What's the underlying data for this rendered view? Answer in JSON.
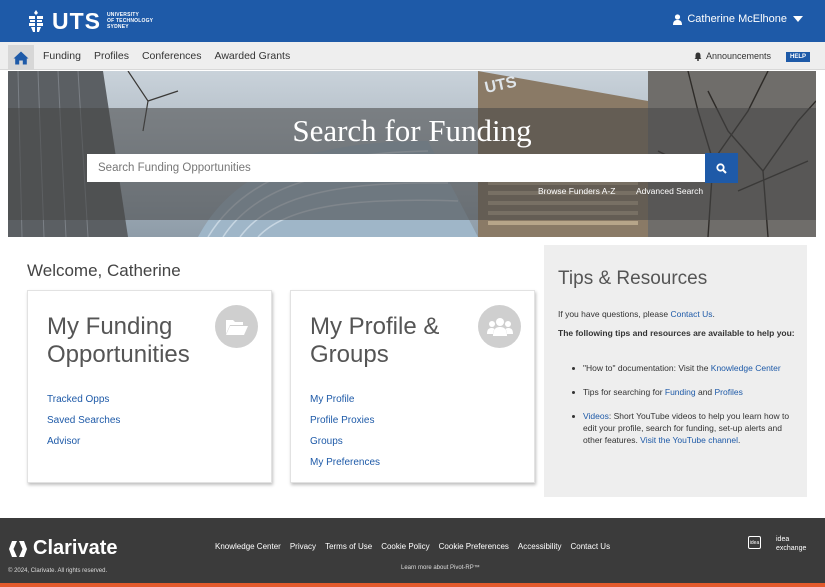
{
  "brand": {
    "logo_text": "UTS",
    "logo_sub": [
      "UNIVERSITY",
      "OF TECHNOLOGY",
      "SYDNEY"
    ]
  },
  "user": {
    "name": "Catherine McElhone"
  },
  "nav": {
    "items": [
      "Funding",
      "Profiles",
      "Conferences",
      "Awarded Grants"
    ],
    "announcements": "Announcements",
    "help": "HELP"
  },
  "hero": {
    "title": "Search for Funding",
    "search_placeholder": "Search Funding Opportunities",
    "browse_link": "Browse Funders A-Z",
    "advanced_link": "Advanced Search"
  },
  "welcome": "Welcome, Catherine",
  "cards": [
    {
      "title": "My Funding Opportunities",
      "icon": "folder-open-icon",
      "links": [
        "Tracked Opps",
        "Saved Searches",
        "Advisor"
      ]
    },
    {
      "title": "My Profile & Groups",
      "icon": "users-icon",
      "links": [
        "My Profile",
        "Profile Proxies",
        "Groups",
        "My Preferences"
      ]
    }
  ],
  "tips": {
    "title": "Tips & Resources",
    "intro_prefix": "If you have questions, please ",
    "intro_link": "Contact Us",
    "intro_suffix": ".",
    "bold_line": "The following tips and resources are available to help you:",
    "item1_prefix": "\"How to\" documentation: Visit the ",
    "item1_link": "Knowledge Center",
    "item2_prefix": "Tips for searching for ",
    "item2_link1": "Funding",
    "item2_mid": " and ",
    "item2_link2": "Profiles",
    "item3_link1": "Videos",
    "item3_text": ": Short YouTube videos to help you learn how to edit your profile, search for funding, set-up alerts and other features. ",
    "item3_link2": "Visit the YouTube channel",
    "item3_suffix": "."
  },
  "footer": {
    "brand": "Clarivate",
    "copyright": "© 2024, Clarivate. All rights reserved.",
    "links": [
      "Knowledge Center",
      "Privacy",
      "Terms of Use",
      "Cookie Policy",
      "Cookie Preferences",
      "Accessibility",
      "Contact Us"
    ],
    "pivot_link": "Learn more about Pivot-RP™",
    "idea_icon_text": "idea",
    "idea_label": [
      "idea",
      "exchange"
    ]
  },
  "colors": {
    "primary": "#1e5aa8",
    "footer_bg": "#3b3b3b",
    "accent": "#e35a2d",
    "panel_bg": "#eeeeee"
  }
}
